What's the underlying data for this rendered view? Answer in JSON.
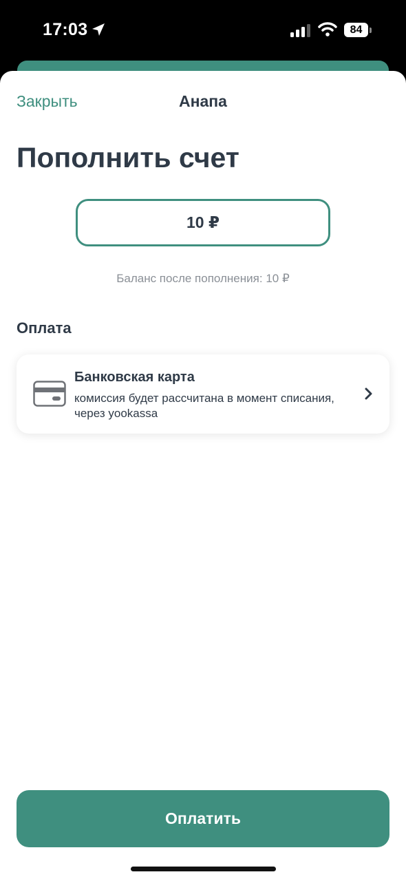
{
  "status_bar": {
    "time": "17:03",
    "battery": "84",
    "icons": [
      "location-arrow-icon",
      "cellular-signal-icon",
      "wifi-icon",
      "battery-icon"
    ]
  },
  "header": {
    "close_label": "Закрыть",
    "title": "Анапа"
  },
  "page": {
    "heading": "Пополнить счет"
  },
  "amount": {
    "value": "10 ₽"
  },
  "balance": {
    "label": "Баланс после пополнения:",
    "value": "10 ₽"
  },
  "payment": {
    "section_title": "Оплата",
    "method_title": "Банковская карта",
    "method_description": "комиссия будет рассчитана в момент списания, через yookassa",
    "method_icon": "credit-card-icon"
  },
  "footer": {
    "pay_label": "Оплатить"
  },
  "colors": {
    "accent": "#3f8f7f",
    "text_primary": "#2f3a47",
    "text_secondary": "#8a8f96"
  }
}
